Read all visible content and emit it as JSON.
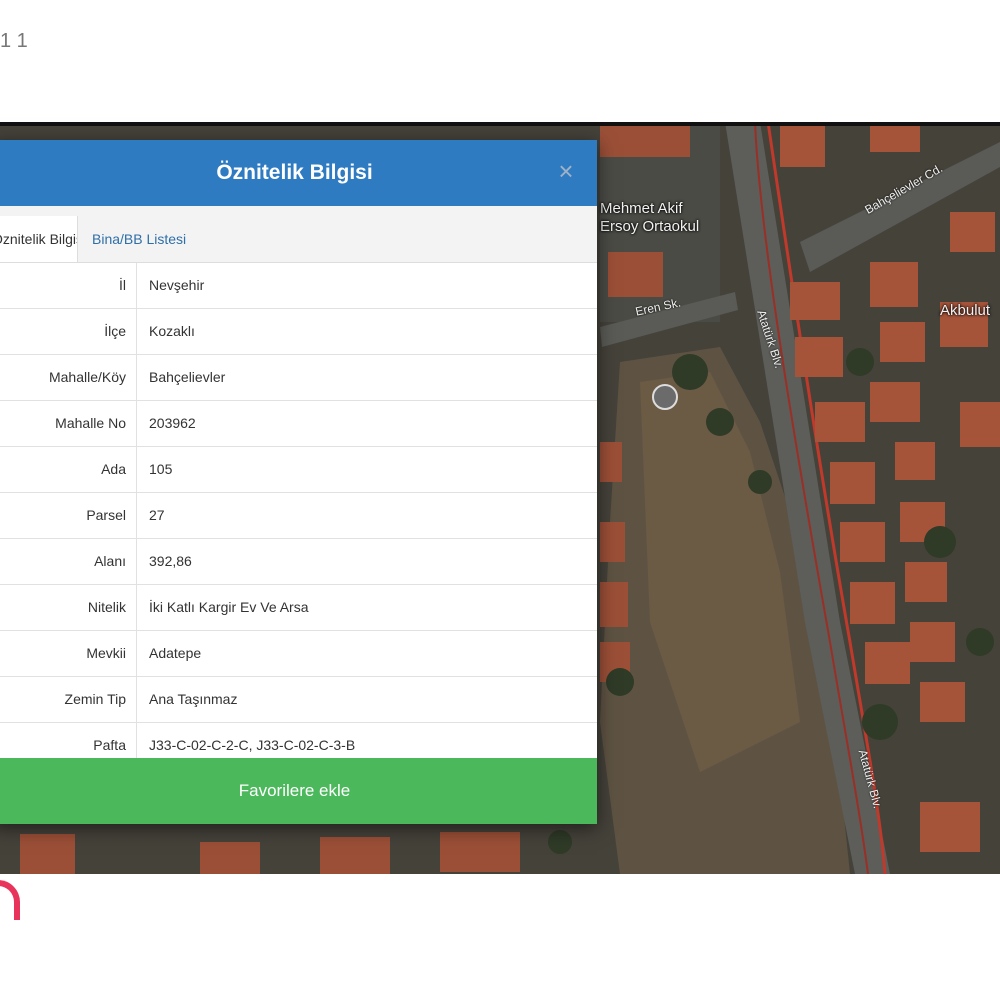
{
  "corner_text": "1 1",
  "map": {
    "labels": {
      "school": "Mehmet Akif Ersoy Ortaokul",
      "street_ataturk_1": "Atatürk Blv.",
      "street_ataturk_2": "Atatürk Blv.",
      "street_eren": "Eren Sk.",
      "street_bahcelievler": "Bahçelievler Cd.",
      "place_akbulut": "Akbulut"
    }
  },
  "dialog": {
    "title": "Öznitelik Bilgisi",
    "close_glyph": "×",
    "tabs": [
      {
        "label": "Öznitelik Bilgisi",
        "active": true
      },
      {
        "label": "Bina/BB Listesi",
        "active": false
      }
    ],
    "rows": [
      {
        "key": "İl",
        "value": "Nevşehir"
      },
      {
        "key": "İlçe",
        "value": "Kozaklı"
      },
      {
        "key": "Mahalle/Köy",
        "value": "Bahçelievler"
      },
      {
        "key": "Mahalle No",
        "value": "203962"
      },
      {
        "key": "Ada",
        "value": "105"
      },
      {
        "key": "Parsel",
        "value": "27"
      },
      {
        "key": "Alanı",
        "value": "392,86"
      },
      {
        "key": "Nitelik",
        "value": "İki Katlı Kargir Ev Ve Arsa"
      },
      {
        "key": "Mevkii",
        "value": "Adatepe"
      },
      {
        "key": "Zemin Tip",
        "value": "Ana Taşınmaz"
      },
      {
        "key": "Pafta",
        "value": "J33-C-02-C-2-C, J33-C-02-C-3-B"
      }
    ],
    "favorite_button": "Favorilere ekle"
  },
  "colors": {
    "header": "#2f7bc2",
    "favorite_button": "#4cb85c",
    "tab_link": "#2f6fa8",
    "brand": "#e8345a"
  }
}
